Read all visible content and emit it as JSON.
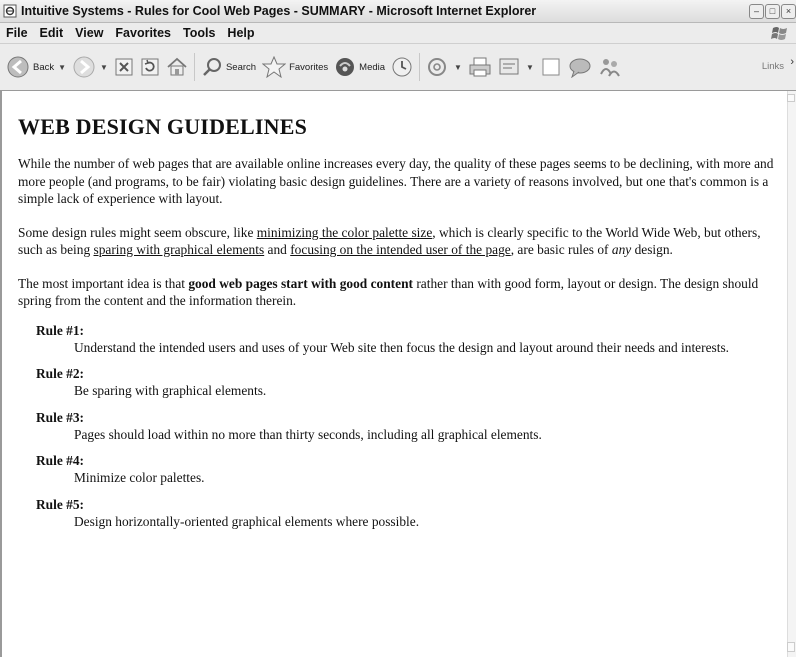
{
  "window": {
    "title": "Intuitive Systems - Rules for Cool Web Pages - SUMMARY - Microsoft Internet Explorer"
  },
  "menu": [
    "File",
    "Edit",
    "View",
    "Favorites",
    "Tools",
    "Help"
  ],
  "toolbar": {
    "back": "Back",
    "search": "Search",
    "favorites": "Favorites",
    "media": "Media",
    "links": "Links",
    "icons": [
      "back-arrow-icon",
      "forward-arrow-icon",
      "stop-icon",
      "refresh-icon",
      "home-icon",
      "search-icon",
      "favorites-star-icon",
      "media-icon",
      "history-icon",
      "mail-icon",
      "print-icon",
      "edit-icon",
      "discuss-icon",
      "messenger-icon",
      "research-icon"
    ]
  },
  "page": {
    "heading": "WEB DESIGN GUIDELINES",
    "p1": "While the number of web pages that are available online increases every day, the quality of these pages seems to be declining, with more and more people (and programs, to be fair) violating basic design guidelines. There are a variety of reasons involved, but one that's common is a simple lack of experience with layout.",
    "p2": {
      "t1": "Some design rules might seem obscure, like ",
      "link1": "minimizing the color palette size",
      "t2": ", which is clearly specific to the World Wide Web, but others, such as being ",
      "link2": "sparing with graphical elements",
      "t3": " and ",
      "link3": "focusing on the intended user of the page",
      "t4": ", are basic rules of ",
      "em": "any",
      "t5": " design."
    },
    "p3": {
      "t1": "The most important idea is that ",
      "bold": "good web pages start with good content",
      "t2": " rather than with good form, layout or design. The design should spring from the content and the information therein."
    },
    "rules": [
      {
        "title": "Rule #1:",
        "text": "Understand the intended users and uses of your Web site then focus the design and layout around their needs and interests."
      },
      {
        "title": "Rule #2:",
        "text": "Be sparing with graphical elements."
      },
      {
        "title": "Rule #3:",
        "text": "Pages should load within no more than thirty seconds, including all graphical elements."
      },
      {
        "title": "Rule #4:",
        "text": "Minimize color palettes."
      },
      {
        "title": "Rule #5:",
        "text": "Design horizontally-oriented graphical elements where possible."
      }
    ]
  }
}
